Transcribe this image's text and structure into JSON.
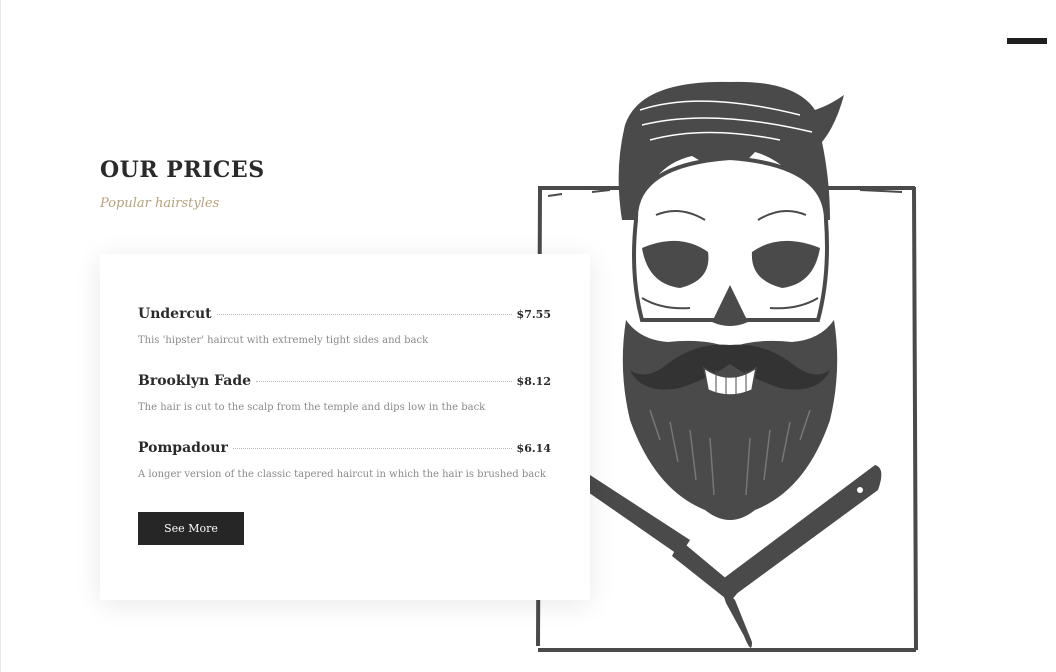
{
  "header": {
    "menu_icon": "hamburger-menu-icon"
  },
  "prices": {
    "title": "OUR PRICES",
    "subtitle": "Popular hairstyles",
    "items": [
      {
        "name": "Undercut",
        "price": "$7.55",
        "description": "This 'hipster' haircut with extremely tight sides and back"
      },
      {
        "name": "Brooklyn Fade",
        "price": "$8.12",
        "description": "The hair is cut to the scalp from the temple and dips low in the back"
      },
      {
        "name": "Pompadour",
        "price": "$6.14",
        "description": "A longer version of the classic tapered haircut in which the hair is brushed back"
      }
    ],
    "button_label": "See More"
  },
  "illustration": {
    "icon": "bearded-skull-razor-illustration"
  },
  "colors": {
    "accent": "#b8a17d",
    "dark": "#262626",
    "text": "#2a2a2a",
    "muted": "#8a8a8a",
    "illustration": "#4a4a4a"
  }
}
